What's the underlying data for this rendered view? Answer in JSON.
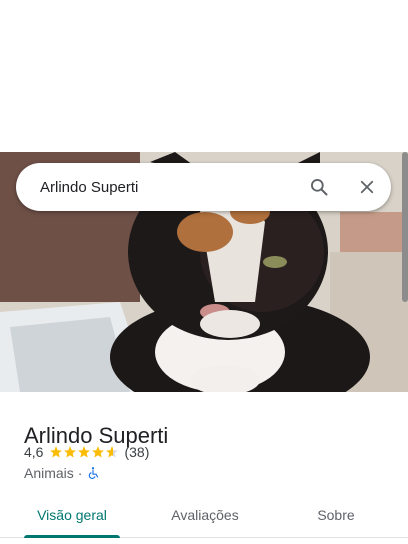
{
  "search": {
    "query": "Arlindo Superti"
  },
  "place": {
    "name": "Arlindo Superti",
    "rating": "4,6",
    "rating_value": 4.6,
    "reviews_count": "(38)",
    "category": "Animais",
    "separator": "·"
  },
  "tabs": [
    {
      "label": "Visão geral",
      "active": true
    },
    {
      "label": "Avaliações",
      "active": false
    },
    {
      "label": "Sobre",
      "active": false
    }
  ],
  "icons": {
    "search": "search-icon",
    "close": "close-icon",
    "star": "star-icon",
    "wheelchair": "wheelchair-accessible-icon"
  },
  "colors": {
    "accent": "#01786f",
    "star": "#fbbc04",
    "accessibility": "#1a73e8"
  }
}
